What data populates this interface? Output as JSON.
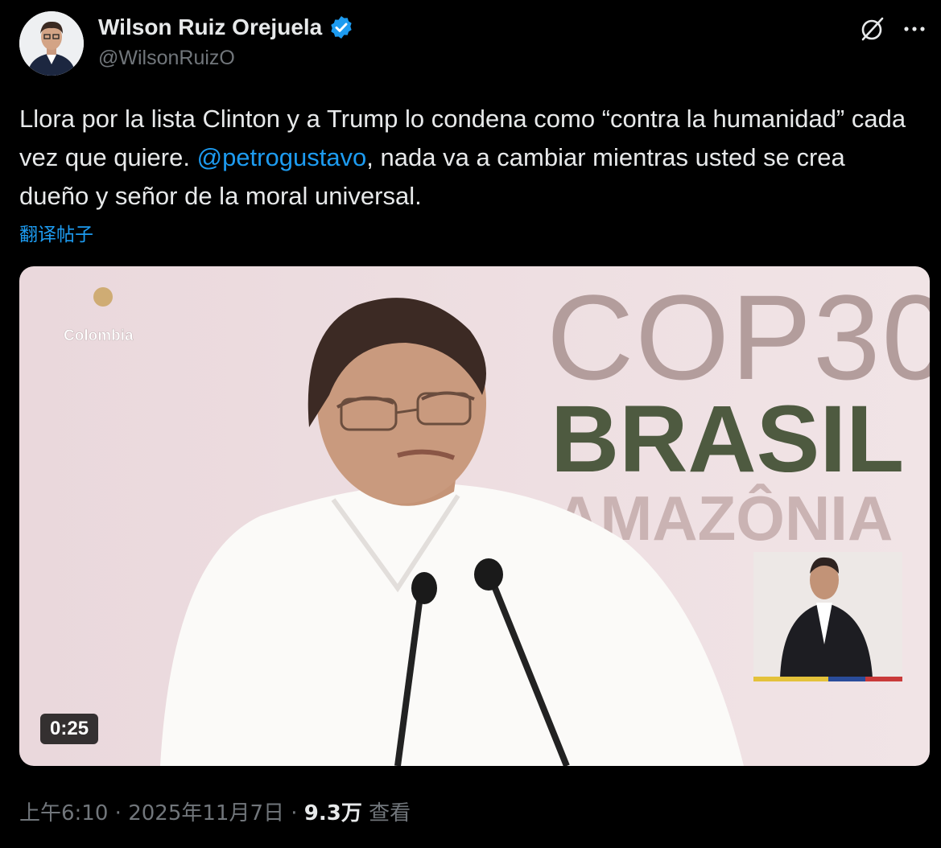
{
  "author": {
    "display_name": "Wilson Ruiz Orejuela",
    "handle": "@WilsonRuizO",
    "verified": true
  },
  "tweet": {
    "text_part1": "Llora por la lista Clinton y a Trump lo condena como “contra la humanidad” cada vez que quiere. ",
    "mention": "@petrogustavo",
    "text_part2": ", nada va a cambiar mientras usted se crea dueño y señor de la moral universal.",
    "translate_label": "翻译帖子"
  },
  "media": {
    "duration": "0:25",
    "logo_text": "Colombia",
    "banner_line1": "COP30",
    "banner_line2": "BRASIL",
    "banner_line3": "AMAZÔNIA"
  },
  "meta": {
    "time": "上午6:10",
    "separator": "·",
    "date": "2025年11月7日",
    "views_count": "9.3万",
    "views_label": "查看"
  },
  "colors": {
    "accent": "#1d9bf0",
    "background": "#000000",
    "text": "#e7e9ea",
    "muted": "#71767b"
  },
  "icons": [
    "verified-badge-icon",
    "grok-icon",
    "more-icon"
  ]
}
